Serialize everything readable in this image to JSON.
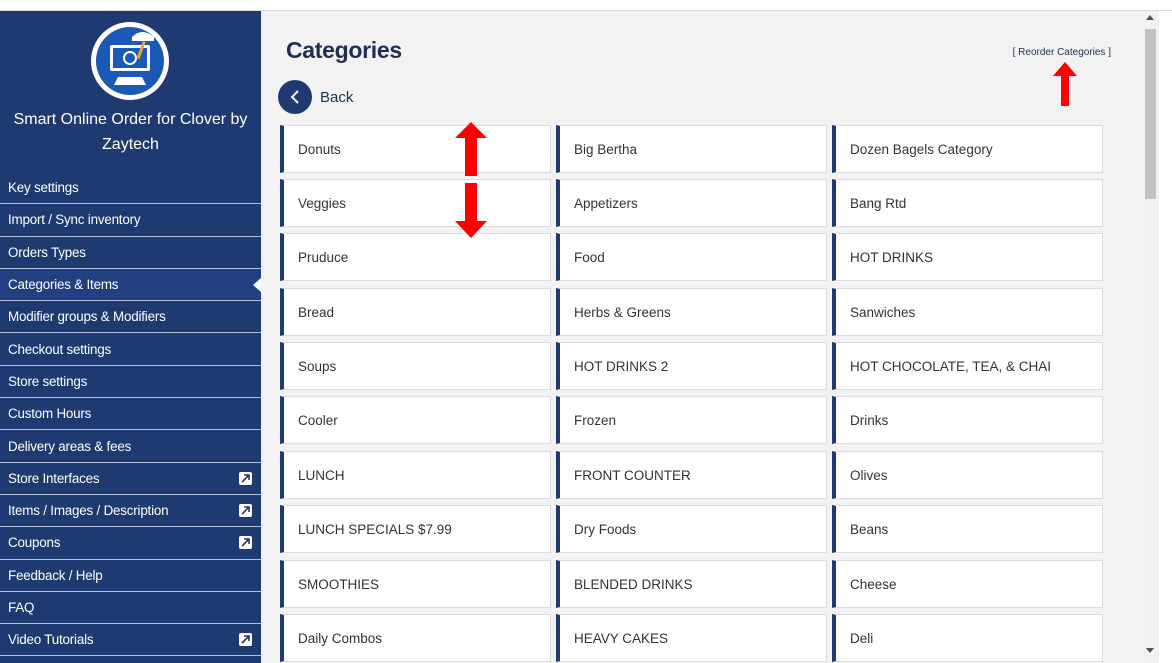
{
  "sidebar": {
    "brand": "Smart Online Order for Clover by Zaytech",
    "items": [
      {
        "label": "Key settings",
        "active": false,
        "external": false
      },
      {
        "label": "Import / Sync inventory",
        "active": false,
        "external": false
      },
      {
        "label": "Orders Types",
        "active": false,
        "external": false
      },
      {
        "label": "Categories & Items",
        "active": true,
        "external": false
      },
      {
        "label": "Modifier groups & Modifiers",
        "active": false,
        "external": false
      },
      {
        "label": "Checkout settings",
        "active": false,
        "external": false
      },
      {
        "label": "Store settings",
        "active": false,
        "external": false
      },
      {
        "label": "Custom Hours",
        "active": false,
        "external": false
      },
      {
        "label": "Delivery areas & fees",
        "active": false,
        "external": false
      },
      {
        "label": "Store Interfaces",
        "active": false,
        "external": true
      },
      {
        "label": "Items / Images / Description",
        "active": false,
        "external": true
      },
      {
        "label": "Coupons",
        "active": false,
        "external": true
      },
      {
        "label": "Feedback / Help",
        "active": false,
        "external": false
      },
      {
        "label": "FAQ",
        "active": false,
        "external": false
      },
      {
        "label": "Video Tutorials",
        "active": false,
        "external": true
      }
    ]
  },
  "main": {
    "title": "Categories",
    "reorder_link": "[ Reorder Categories ]",
    "back_label": "Back",
    "categories": [
      [
        "Donuts",
        "Big Bertha",
        "Dozen Bagels Category"
      ],
      [
        "Veggies",
        "Appetizers",
        "Bang Rtd"
      ],
      [
        "Pruduce",
        "Food",
        "HOT DRINKS"
      ],
      [
        "Bread",
        "Herbs & Greens",
        "Sanwiches"
      ],
      [
        "Soups",
        "HOT DRINKS 2",
        "HOT CHOCOLATE, TEA, & CHAI"
      ],
      [
        "Cooler",
        "Frozen",
        "Drinks"
      ],
      [
        "LUNCH",
        "FRONT COUNTER",
        "Olives"
      ],
      [
        "LUNCH SPECIALS $7.99",
        "Dry Foods",
        "Beans"
      ],
      [
        "SMOOTHIES",
        "BLENDED DRINKS",
        "Cheese"
      ],
      [
        "Daily Combos",
        "HEAVY CAKES",
        "Deli"
      ]
    ]
  },
  "colors": {
    "sidebar_bg": "#1f3a70",
    "accent": "#1f3a70",
    "annotation_arrow": "#ff0000"
  }
}
